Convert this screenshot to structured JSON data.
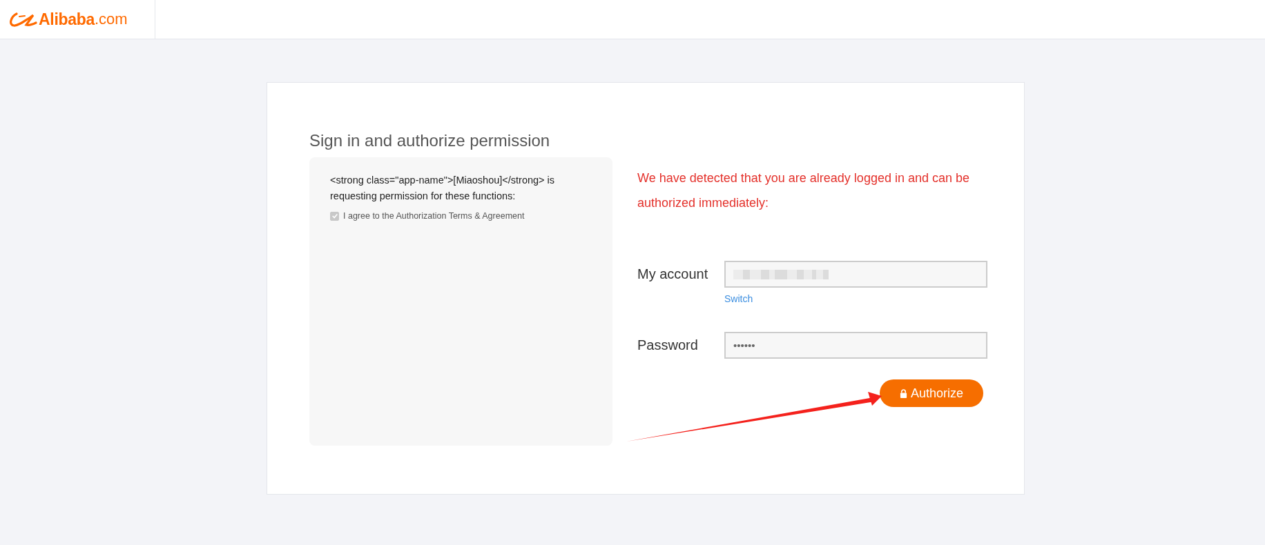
{
  "header": {
    "logo": {
      "word": "Alibaba",
      "suffix": ".com"
    }
  },
  "card": {
    "title": "Sign in and authorize permission",
    "permissions": {
      "request_text": "<strong class=\"app-name\">[Miaoshou]</strong> is requesting permission for these functions:",
      "agreement": {
        "label": "I agree to the Authorization Terms & Agreement",
        "checked": true,
        "disabled": true
      }
    },
    "notice": "We have detected that you are already logged in and can be authorized immediately:",
    "account": {
      "label": "My account",
      "redacted": true,
      "link": "Switch"
    },
    "password": {
      "label": "Password",
      "value": "••••••"
    },
    "authorize_button": {
      "label": "Authorize"
    }
  }
}
